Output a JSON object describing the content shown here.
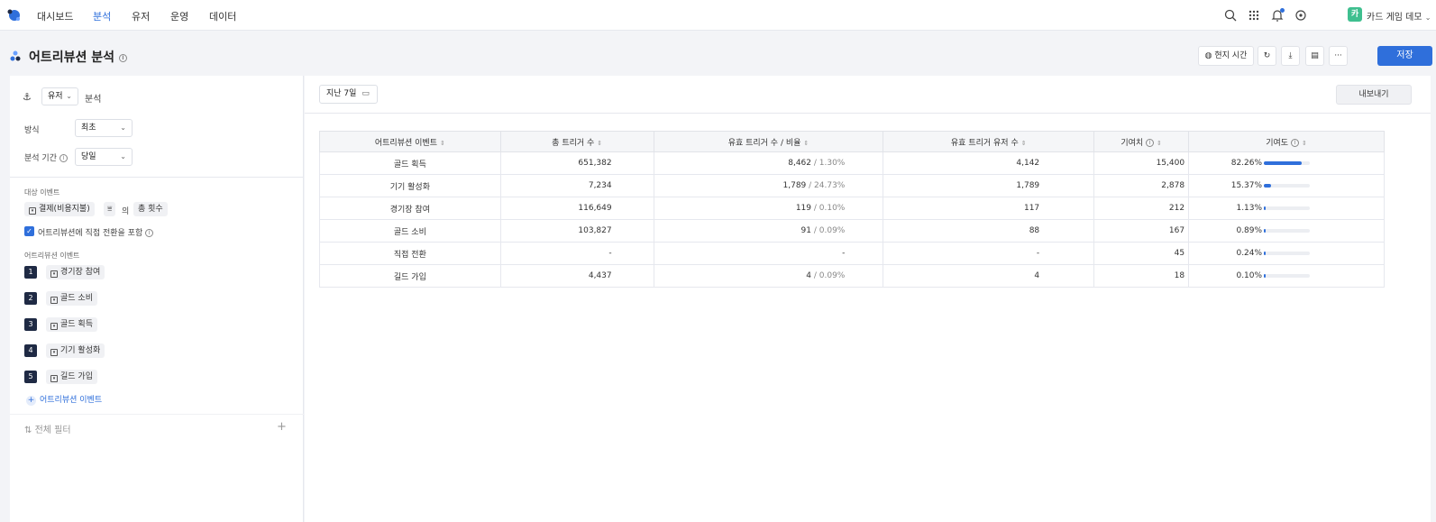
{
  "nav": {
    "items": [
      "대시보드",
      "분석",
      "유저",
      "운영",
      "데이터"
    ],
    "active_index": 1,
    "user_avatar": "카",
    "user_name": "카드 게임 데모"
  },
  "header": {
    "title": "어트리뷰션 분석",
    "local_time_label": "현지 시간",
    "more_label": "···",
    "save_label": "저장"
  },
  "left": {
    "subject_select": "유저",
    "subject_suffix": "분석",
    "method_label": "방식",
    "method_value": "최초",
    "period_label": "분석 기간",
    "period_value": "당일",
    "target_section": "대상 이벤트",
    "target_event": "결제(비용지불)",
    "target_of": "의",
    "target_metric": "총 횟수",
    "include_label": "어트리뷰션에 직접 전환을 포함",
    "attr_section": "어트리뷰션 이벤트",
    "attr_events": [
      {
        "num": "1",
        "label": "경기장 참여"
      },
      {
        "num": "2",
        "label": "골드 소비"
      },
      {
        "num": "3",
        "label": "골드 획득"
      },
      {
        "num": "4",
        "label": "기기 활성화"
      },
      {
        "num": "5",
        "label": "길드 가입"
      }
    ],
    "add_event_label": "어트리뷰션 이벤트",
    "filter_label": "전체 필터"
  },
  "main": {
    "date_range": "지난 7일",
    "export_label": "내보내기",
    "columns": [
      "어트리뷰션 이벤트",
      "총 트리거 수",
      "유효 트리거 수 / 비율",
      "유효 트리거 유저 수",
      "기여치",
      "기여도"
    ],
    "rows": [
      {
        "event": "골드 획득",
        "total": "651,382",
        "valid": "8,462",
        "ratio": " / 1.30%",
        "users": "4,142",
        "contrib_value": "15,400",
        "contrib_pct": "82.26%",
        "contrib_fraction": 0.8226
      },
      {
        "event": "기기 활성화",
        "total": "7,234",
        "valid": "1,789",
        "ratio": " / 24.73%",
        "users": "1,789",
        "contrib_value": "2,878",
        "contrib_pct": "15.37%",
        "contrib_fraction": 0.1537
      },
      {
        "event": "경기장 참여",
        "total": "116,649",
        "valid": "119",
        "ratio": " / 0.10%",
        "users": "117",
        "contrib_value": "212",
        "contrib_pct": "1.13%",
        "contrib_fraction": 0.0113
      },
      {
        "event": "골드 소비",
        "total": "103,827",
        "valid": "91",
        "ratio": " / 0.09%",
        "users": "88",
        "contrib_value": "167",
        "contrib_pct": "0.89%",
        "contrib_fraction": 0.0089
      },
      {
        "event": "직접 전환",
        "total": "-",
        "valid": "-",
        "ratio": "",
        "users": "-",
        "contrib_value": "45",
        "contrib_pct": "0.24%",
        "contrib_fraction": 0.0024
      },
      {
        "event": "길드 가입",
        "total": "4,437",
        "valid": "4",
        "ratio": " / 0.09%",
        "users": "4",
        "contrib_value": "18",
        "contrib_pct": "0.10%",
        "contrib_fraction": 0.001
      }
    ]
  },
  "colors": {
    "accent": "#2f6fdb",
    "badge": "#1f2a44",
    "avatar": "#3fbf8f"
  }
}
